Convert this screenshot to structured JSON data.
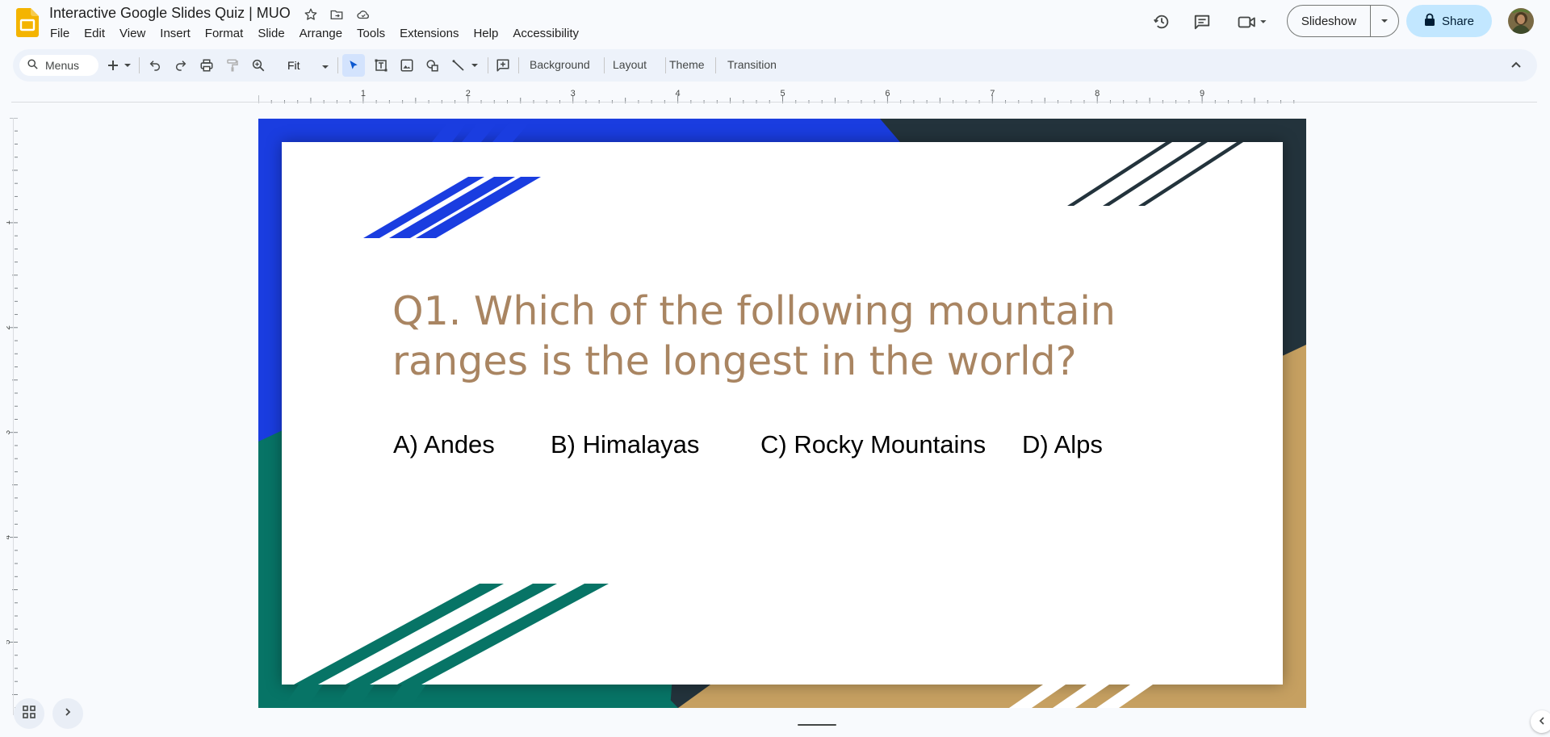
{
  "app": {
    "title": "Interactive Google Slides Quiz | MUO",
    "logo_icon": "google-slides-logo",
    "title_icons": [
      "star-icon",
      "move-to-folder-icon",
      "cloud-saved-icon"
    ]
  },
  "menu": {
    "items": [
      "File",
      "Edit",
      "View",
      "Insert",
      "Format",
      "Slide",
      "Arrange",
      "Tools",
      "Extensions",
      "Help",
      "Accessibility"
    ]
  },
  "header_actions": {
    "icons": [
      "version-history-icon",
      "comments-icon",
      "meet-icon"
    ],
    "slideshow_label": "Slideshow",
    "share_label": "Share"
  },
  "toolbar": {
    "search_placeholder": "Menus",
    "zoom_value": "Fit",
    "background_label": "Background",
    "layout_label": "Layout",
    "theme_label": "Theme",
    "transition_label": "Transition"
  },
  "ruler": {
    "horizontal_labels": [
      "1",
      "2",
      "3",
      "4",
      "5",
      "6",
      "7",
      "8",
      "9"
    ],
    "vertical_labels": [
      "1",
      "2",
      "3",
      "4",
      "5"
    ]
  },
  "slide": {
    "question": "Q1. Which of the following mountain ranges is the longest in the world?",
    "answers": [
      "A) Andes",
      "B) Himalayas",
      "C) Rocky Mountains",
      "D) Alps"
    ],
    "colors": {
      "blue": "#1a3de0",
      "dark_slate": "#23333c",
      "tan": "#c6a061",
      "teal": "#077466",
      "question_text": "#a98562"
    }
  },
  "accent": {
    "share_bg": "#c2e7ff",
    "toolbar_bg": "#edf2fa",
    "selected_tool_bg": "#d3e3fd"
  }
}
